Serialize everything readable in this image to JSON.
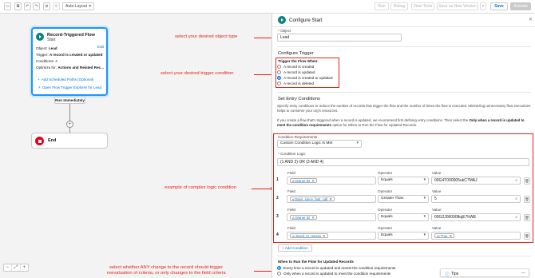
{
  "toolbar": {
    "auto_layout": "Auto-Layout",
    "run": "Run",
    "debug": "Debug",
    "view_tests": "View Tests",
    "save_new_version": "Save as New Version",
    "save": "Save",
    "activate": "Activate"
  },
  "canvas": {
    "start": {
      "title": "Record-Triggered Flow",
      "subtitle": "Start",
      "object_label": "Object:",
      "object_value": "Lead",
      "edit": "Edit",
      "trigger_label": "Trigger:",
      "trigger_value": "A record is created or updated",
      "conditions_label": "Conditions:",
      "conditions_value": "4",
      "optimize_label": "Optimize for:",
      "optimize_value": "Actions and Related Rec...",
      "add_paths": "Add Scheduled Paths (Optional)",
      "explorer": "Open Flow Trigger Explorer for Lead"
    },
    "run_immediately": "Run Immediately",
    "end_label": "End"
  },
  "annotations": {
    "object": "select your desired object type",
    "trigger": "select your desired trigger condition",
    "logic": "example of complex logic condition",
    "reeval_line1": "select whether ANY change to the record should trigger",
    "reeval_line2": "reevaluation of criteria, or only changes to the field criteria"
  },
  "panel": {
    "title": "Configure Start",
    "object_label": "Object",
    "object_value": "Lead",
    "configure_trigger": "Configure Trigger",
    "trigger_when": "Trigger the Flow When:",
    "trigger_options": [
      {
        "label": "A record is created",
        "selected": false
      },
      {
        "label": "A record is updated",
        "selected": false
      },
      {
        "label": "A record is created or updated",
        "selected": true
      },
      {
        "label": "A record is deleted",
        "selected": false
      }
    ],
    "entry_title": "Set Entry Conditions",
    "entry_desc": "Specify entry conditions to reduce the number of records that trigger the flow and the number of times the flow is executed. Minimizing unnecessary flow executions helps to conserve your org's resources.",
    "entry_desc2_a": "If you create a flow that's triggered when a record is updated, we recommend first defining entry conditions. Then select the",
    "entry_desc2_b": "Only when a record is updated to meet the condition requirements",
    "entry_desc2_c": "option for When to Run the Flow for Updated Records.",
    "condition_req_label": "Condition Requirements",
    "condition_req_value": "Custom Condition Logic Is Met",
    "condition_logic_label": "Condition Logic",
    "condition_logic_value": "(1 AND 2) OR (3 AND 4)",
    "field_header": "Field",
    "operator_header": "Operator",
    "value_header": "Value",
    "conditions": [
      {
        "num": "1",
        "field": "Owner ID",
        "icon": "A",
        "operator": "Equals",
        "value": "00G4T000005ukC7MAJ",
        "value_pill": ""
      },
      {
        "num": "2",
        "field": "Days_since_last_call",
        "icon": "#",
        "operator": "Greater Than",
        "value": "5",
        "value_pill": ""
      },
      {
        "num": "3",
        "field": "Owner ID",
        "icon": "A",
        "operator": "Equals",
        "value": "00G2J000008ujE7hWE",
        "value_pill": ""
      },
      {
        "num": "4",
        "field": "Send_to_Ineera",
        "icon": "☑",
        "operator": "Equals",
        "value": "",
        "value_pill": "True"
      }
    ],
    "add_condition": "+ Add Condition",
    "when_to_run_title": "When to Run the Flow for Updated Records",
    "run_options": [
      {
        "label": "Every time a record is updated and meets the condition requirements",
        "selected": true
      },
      {
        "label": "Only when a record is updated to meet the condition requirements",
        "selected": false
      }
    ]
  },
  "tips": {
    "label": "Tips"
  },
  "colors": {
    "accent": "#0176d3",
    "annotation": "#e2231a",
    "start_icon": "#0b827c",
    "end_icon": "#ea001e"
  }
}
